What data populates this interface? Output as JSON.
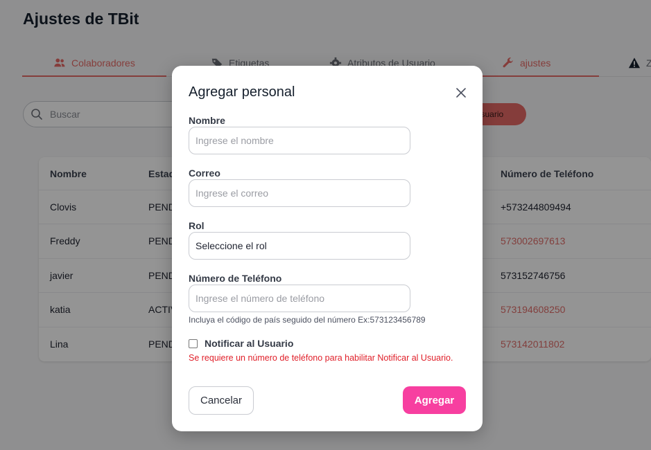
{
  "page": {
    "title": "Ajustes de TBit"
  },
  "tabs": [
    {
      "label": "Colaboradores",
      "icon": "users-icon"
    },
    {
      "label": "Etiquetas",
      "icon": "tag-icon"
    },
    {
      "label": "Atributos de Usuario",
      "icon": "gear-icon"
    },
    {
      "label": "ajustes",
      "icon": "wrench-icon"
    },
    {
      "label": "Z",
      "icon": "warning-icon"
    }
  ],
  "search": {
    "placeholder": "Buscar"
  },
  "toolbar": {
    "add_user_label": "ar usuario"
  },
  "table": {
    "columns": [
      "Nombre",
      "Estad",
      "Número de Teléfono"
    ],
    "rows": [
      {
        "name": "Clovis",
        "status": "PEND",
        "phone": "+573244809494",
        "phone_link": false
      },
      {
        "name": "Freddy",
        "status": "PEND",
        "phone": "573002697613",
        "phone_link": true
      },
      {
        "name": "javier",
        "status": "PEND",
        "phone": "573152746756",
        "phone_link": false
      },
      {
        "name": "katia",
        "status": "ACTIV",
        "phone": "573194608250",
        "phone_link": true
      },
      {
        "name": "Lina",
        "status": "PEND",
        "phone": "573142011802",
        "phone_link": true
      }
    ]
  },
  "modal": {
    "title": "Agregar personal",
    "fields": {
      "name": {
        "label": "Nombre",
        "placeholder": "Ingrese el nombre"
      },
      "email": {
        "label": "Correo",
        "placeholder": "Ingrese el correo"
      },
      "role": {
        "label": "Rol",
        "value": "Seleccione el rol"
      },
      "phone": {
        "label": "Número de Teléfono",
        "placeholder": "Ingrese el número de teléfono",
        "hint": "Incluya el código de país seguido del número Ex:573123456789"
      }
    },
    "notify": {
      "label": "Notificar al Usuario",
      "checked": false,
      "error": "Se requiere un número de teléfono para habilitar Notificar al Usuario."
    },
    "cancel_label": "Cancelar",
    "submit_label": "Agregar"
  },
  "colors": {
    "accent": "#e66a66",
    "primary_button": "#f73fa0",
    "error": "#e0202a"
  }
}
